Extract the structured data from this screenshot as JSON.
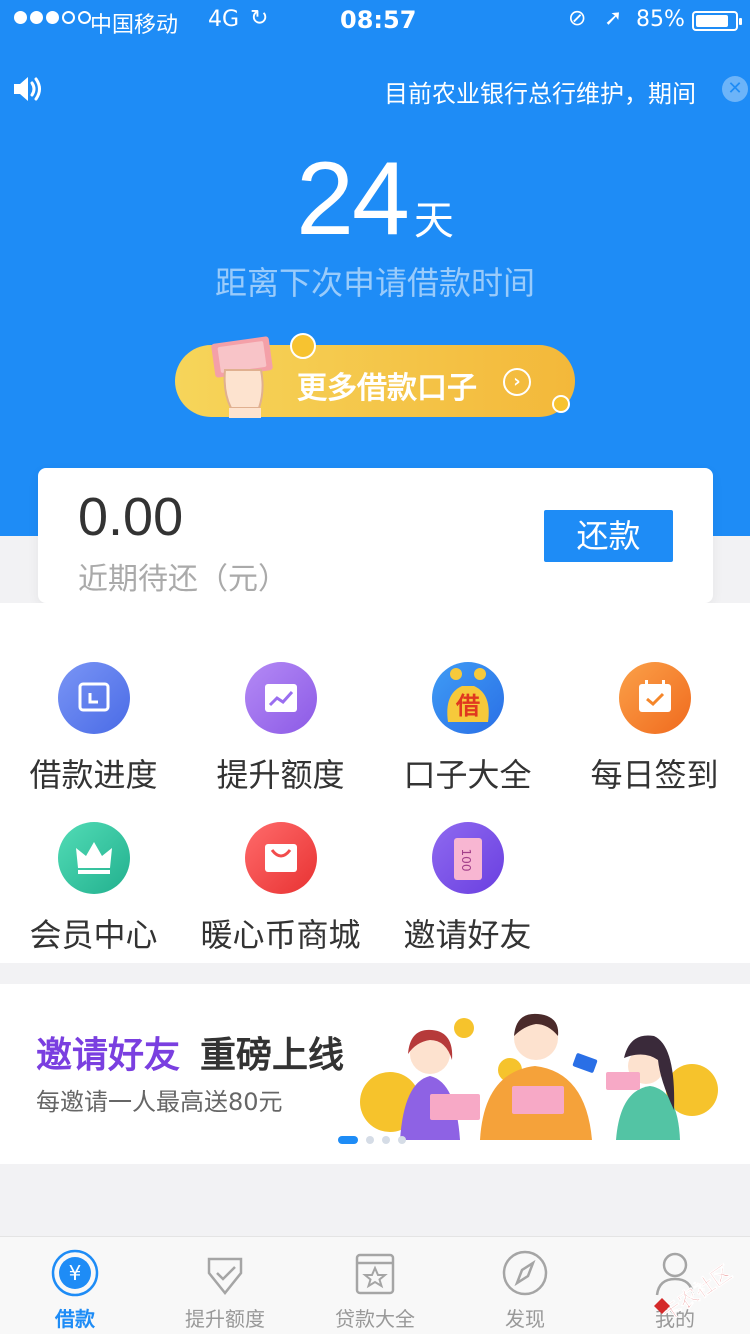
{
  "status": {
    "carrier": "中国移动",
    "network": "4G",
    "time": "08:57",
    "battery_pct": "85%",
    "battery_level": 0.85,
    "signal_bars": 3
  },
  "notice": {
    "text": "目前农业银行总行维护，期间"
  },
  "countdown": {
    "number": "24",
    "unit": "天",
    "caption": "距离下次申请借款时间"
  },
  "more_button": {
    "label": "更多借款口子"
  },
  "repay_card": {
    "amount": "0.00",
    "caption": "近期待还（元）",
    "button": "还款"
  },
  "grid": [
    {
      "label": "借款进度",
      "icon": "clock-icon",
      "color": "#5b7bf0"
    },
    {
      "label": "提升额度",
      "icon": "trend-up-icon",
      "color": "#a06ff0"
    },
    {
      "label": "口子大全",
      "icon": "money-bag-icon",
      "color": "#2a8cf0"
    },
    {
      "label": "每日签到",
      "icon": "calendar-check-icon",
      "color": "#f5862a"
    },
    {
      "label": "会员中心",
      "icon": "crown-icon",
      "color": "#35c9a4"
    },
    {
      "label": "暖心币商城",
      "icon": "shopping-bag-icon",
      "color": "#f24c4c"
    },
    {
      "label": "邀请好友",
      "icon": "invite-ticket-icon",
      "color": "#7c52e0"
    }
  ],
  "banner": {
    "title_highlight": "邀请好友",
    "title_rest": "重磅上线",
    "subtitle": "每邀请一人最高送80元",
    "page_count": 4,
    "active_page": 1
  },
  "tabs": [
    {
      "label": "借款",
      "icon": "yen-circle-icon",
      "active": true
    },
    {
      "label": "提升额度",
      "icon": "shield-check-icon",
      "active": false
    },
    {
      "label": "贷款大全",
      "icon": "star-book-icon",
      "active": false
    },
    {
      "label": "发现",
      "icon": "compass-icon",
      "active": false
    },
    {
      "label": "我的",
      "icon": "user-icon",
      "active": false
    }
  ],
  "watermark": "卡农社区",
  "colors": {
    "primary": "#1e8cf6",
    "accent_gold": "#f3b83a",
    "invite_purple": "#7a3fe0"
  }
}
